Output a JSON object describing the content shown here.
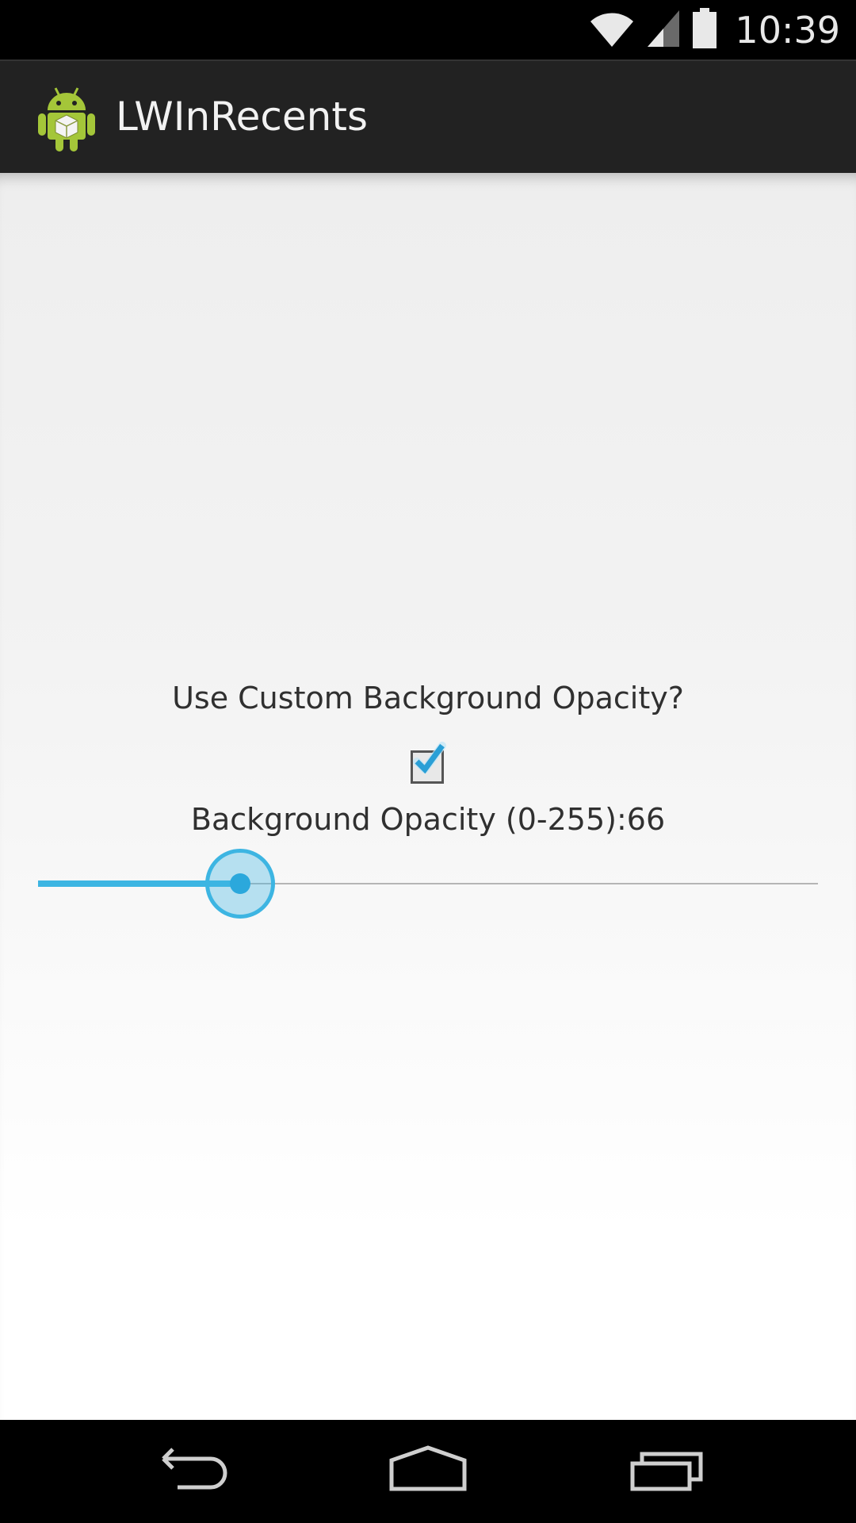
{
  "status_bar": {
    "time": "10:39",
    "icons": [
      "wifi-icon",
      "signal-icon",
      "battery-icon"
    ]
  },
  "action_bar": {
    "title": "LWInRecents",
    "icon": "android-app-icon"
  },
  "settings": {
    "custom_opacity_label": "Use Custom Background Opacity?",
    "custom_opacity_checked": true,
    "opacity_label": "Background Opacity (0-255):66",
    "opacity_value": 66,
    "opacity_max": 255
  },
  "nav_bar": {
    "icons": [
      "back-icon",
      "home-icon",
      "recents-icon"
    ]
  },
  "colors": {
    "accent": "#3db5e2",
    "action_bar": "#222222",
    "android_green": "#a4c639"
  }
}
